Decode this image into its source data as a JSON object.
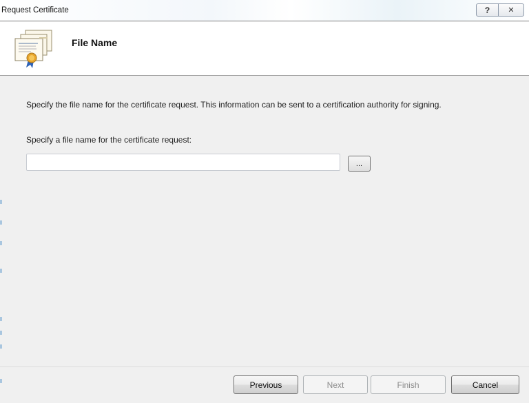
{
  "window": {
    "title": "Request Certificate",
    "help_glyph": "?",
    "close_glyph": "✕"
  },
  "header": {
    "title": "File Name",
    "icon": "certificate-icon"
  },
  "content": {
    "description": "Specify the file name for the certificate request. This information can be sent to a certification authority for signing.",
    "file_label": "Specify a file name for the certificate request:",
    "file_input_value": "",
    "browse_label": "..."
  },
  "footer": {
    "previous_label": "Previous",
    "next_label": "Next",
    "finish_label": "Finish",
    "cancel_label": "Cancel"
  },
  "colors": {
    "dialog_bg": "#f0f0f0",
    "header_bg": "#ffffff",
    "disabled_text": "#8d8d8d"
  }
}
